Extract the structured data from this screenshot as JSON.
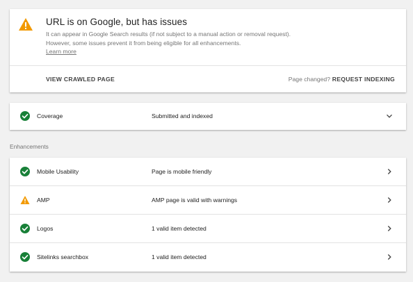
{
  "status": {
    "title": "URL is on Google, but has issues",
    "description": "It can appear in Google Search results (if not subject to a manual action or removal request). However, some issues prevent it from being eligible for all enhancements.",
    "learn_more": "Learn more",
    "view_crawled_label": "VIEW CRAWLED PAGE",
    "page_changed": "Page changed?",
    "request_indexing_label": "REQUEST INDEXING",
    "icon": "warning-icon"
  },
  "coverage": {
    "name": "Coverage",
    "status": "Submitted and indexed",
    "icon": "check-circle-icon",
    "arrow": "chevron-down-icon"
  },
  "enhancements": {
    "title": "Enhancements",
    "items": [
      {
        "name": "Mobile Usability",
        "status": "Page is mobile friendly",
        "icon": "check-circle-icon"
      },
      {
        "name": "AMP",
        "status": "AMP page is valid with warnings",
        "icon": "warning-icon"
      },
      {
        "name": "Logos",
        "status": "1 valid item detected",
        "icon": "check-circle-icon"
      },
      {
        "name": "Sitelinks searchbox",
        "status": "1 valid item detected",
        "icon": "check-circle-icon"
      }
    ]
  },
  "colors": {
    "success": "#188038",
    "warning": "#f29900",
    "background": "#f1f1f1"
  }
}
